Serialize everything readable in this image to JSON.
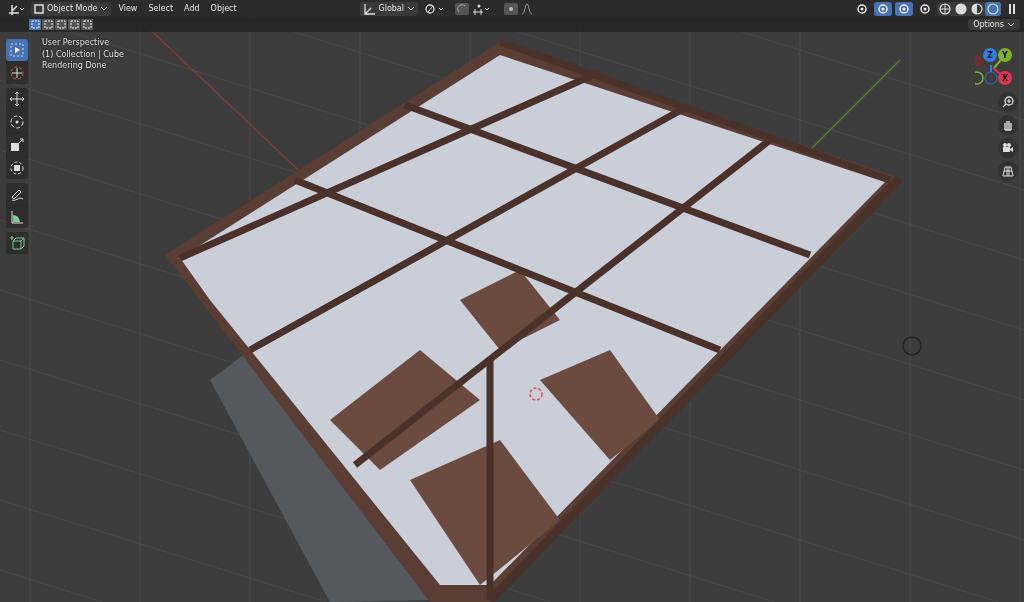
{
  "header": {
    "mode": "Object Mode",
    "menus": [
      "View",
      "Select",
      "Add",
      "Object"
    ],
    "orientation": "Global",
    "viewport_toggles": [
      {
        "selected": false
      },
      {
        "selected": true
      },
      {
        "selected": true
      },
      {
        "selected": false
      }
    ],
    "shading_modes": [
      {
        "selected": false
      },
      {
        "selected": false
      },
      {
        "selected": false
      },
      {
        "selected": true
      }
    ]
  },
  "tool_settings": {
    "select_modes": [
      {
        "selected": true
      },
      {
        "selected": false
      },
      {
        "selected": false
      },
      {
        "selected": false
      },
      {
        "selected": false
      }
    ],
    "options": "Options"
  },
  "overlay_text": [
    "User Perspective",
    "(1) Collection | Cube",
    "Rendering Done"
  ],
  "toolbar": {
    "groups": [
      {
        "tools": [
          {
            "selected": true
          },
          {
            "selected": false
          }
        ]
      },
      {
        "tools": [
          {
            "selected": false
          },
          {
            "selected": false
          },
          {
            "selected": false
          },
          {
            "selected": false
          }
        ]
      },
      {
        "tools": [
          {
            "selected": false
          },
          {
            "selected": false
          }
        ]
      },
      {
        "tools": [
          {
            "selected": false
          }
        ]
      }
    ]
  },
  "gizmo": {
    "axes": [
      {
        "label": "Z",
        "color": "#2f7fe0"
      },
      {
        "label": "Y",
        "color": "#7fb126"
      },
      {
        "label": "X",
        "color": "#e0344f"
      }
    ]
  }
}
